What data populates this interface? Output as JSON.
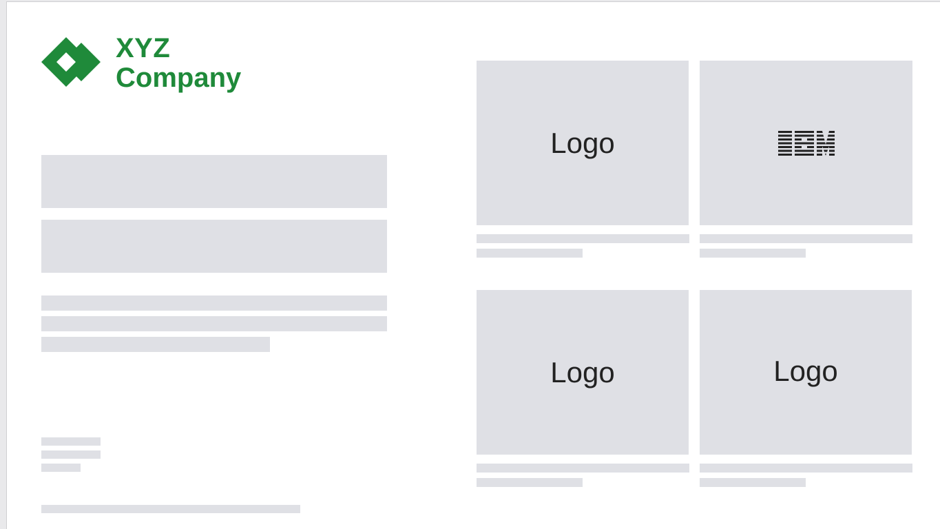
{
  "brand": {
    "line1": "XYZ",
    "line2": "Company",
    "color": "#1f8a3a",
    "icon": "diamond-logo-icon"
  },
  "tiles": [
    {
      "label": "Logo"
    },
    {
      "label": "IBM",
      "icon": "ibm-logo-icon"
    },
    {
      "label": "Logo"
    },
    {
      "label": "Logo"
    }
  ],
  "colors": {
    "placeholder": "#dfe0e5",
    "background": "#ffffff",
    "text": "#222222"
  }
}
